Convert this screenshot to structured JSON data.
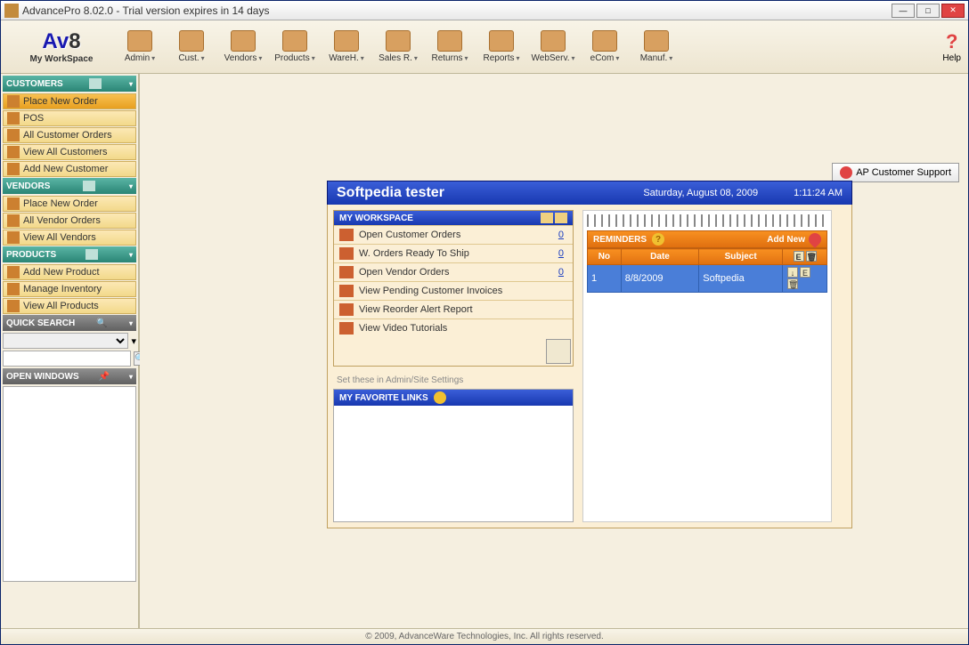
{
  "window": {
    "title": "AdvancePro 8.02.0 - Trial version expires in 14 days"
  },
  "logo": {
    "top": "Av",
    "eight": "8",
    "bottom": "My WorkSpace"
  },
  "toolbar": [
    {
      "label": "Admin"
    },
    {
      "label": "Cust."
    },
    {
      "label": "Vendors"
    },
    {
      "label": "Products"
    },
    {
      "label": "WareH."
    },
    {
      "label": "Sales R."
    },
    {
      "label": "Returns"
    },
    {
      "label": "Reports"
    },
    {
      "label": "WebServ."
    },
    {
      "label": "eCom"
    },
    {
      "label": "Manuf."
    }
  ],
  "help_label": "Help",
  "sidebar": {
    "customers": {
      "title": "CUSTOMERS",
      "items": [
        "Place New Order",
        "POS",
        "All Customer Orders",
        "View All Customers",
        "Add New Customer"
      ]
    },
    "vendors": {
      "title": "VENDORS",
      "items": [
        "Place New Order",
        "All Vendor Orders",
        "View All Vendors"
      ]
    },
    "products": {
      "title": "PRODUCTS",
      "items": [
        "Add New Product",
        "Manage Inventory",
        "View All Products"
      ]
    },
    "quicksearch": {
      "title": "QUICK SEARCH"
    },
    "openwindows": {
      "title": "OPEN WINDOWS"
    }
  },
  "support_btn": "AP Customer Support",
  "workspace": {
    "name": "Softpedia tester",
    "date": "Saturday, August 08, 2009",
    "time": "1:11:24 AM",
    "my_workspace_title": "MY WORKSPACE",
    "rows": [
      {
        "label": "Open Customer Orders",
        "value": "0"
      },
      {
        "label": "W. Orders Ready To Ship",
        "value": "0"
      },
      {
        "label": "Open Vendor Orders",
        "value": "0"
      },
      {
        "label": "View Pending Customer Invoices",
        "value": ""
      },
      {
        "label": "View Reorder Alert Report",
        "value": ""
      },
      {
        "label": "View Video Tutorials",
        "value": ""
      }
    ],
    "fav_note": "Set these in Admin/Site Settings",
    "fav_title": "MY FAVORITE LINKS",
    "reminders": {
      "title": "REMINDERS",
      "add_new": "Add New",
      "cols": [
        "No",
        "Date",
        "Subject"
      ],
      "items": [
        {
          "no": "1",
          "date": "8/8/2009",
          "subject": "Softpedia"
        }
      ]
    }
  },
  "statusbar": "© 2009, AdvanceWare Technologies, Inc. All rights reserved."
}
